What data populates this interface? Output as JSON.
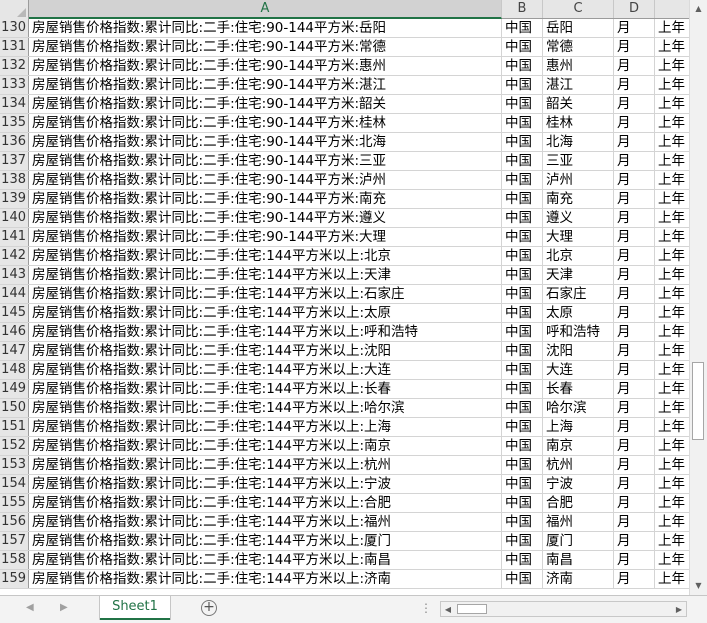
{
  "columns": [
    "A",
    "B",
    "C",
    "D",
    ""
  ],
  "selected_column": "A",
  "rows": [
    {
      "n": "130",
      "a": "房屋销售价格指数:累计同比:二手:住宅:90-144平方米:岳阳",
      "b": "中国",
      "c": "岳阳",
      "d": "月",
      "e": "上年"
    },
    {
      "n": "131",
      "a": "房屋销售价格指数:累计同比:二手:住宅:90-144平方米:常德",
      "b": "中国",
      "c": "常德",
      "d": "月",
      "e": "上年"
    },
    {
      "n": "132",
      "a": "房屋销售价格指数:累计同比:二手:住宅:90-144平方米:惠州",
      "b": "中国",
      "c": "惠州",
      "d": "月",
      "e": "上年"
    },
    {
      "n": "133",
      "a": "房屋销售价格指数:累计同比:二手:住宅:90-144平方米:湛江",
      "b": "中国",
      "c": "湛江",
      "d": "月",
      "e": "上年"
    },
    {
      "n": "134",
      "a": "房屋销售价格指数:累计同比:二手:住宅:90-144平方米:韶关",
      "b": "中国",
      "c": "韶关",
      "d": "月",
      "e": "上年"
    },
    {
      "n": "135",
      "a": "房屋销售价格指数:累计同比:二手:住宅:90-144平方米:桂林",
      "b": "中国",
      "c": "桂林",
      "d": "月",
      "e": "上年"
    },
    {
      "n": "136",
      "a": "房屋销售价格指数:累计同比:二手:住宅:90-144平方米:北海",
      "b": "中国",
      "c": "北海",
      "d": "月",
      "e": "上年"
    },
    {
      "n": "137",
      "a": "房屋销售价格指数:累计同比:二手:住宅:90-144平方米:三亚",
      "b": "中国",
      "c": "三亚",
      "d": "月",
      "e": "上年"
    },
    {
      "n": "138",
      "a": "房屋销售价格指数:累计同比:二手:住宅:90-144平方米:泸州",
      "b": "中国",
      "c": "泸州",
      "d": "月",
      "e": "上年"
    },
    {
      "n": "139",
      "a": "房屋销售价格指数:累计同比:二手:住宅:90-144平方米:南充",
      "b": "中国",
      "c": "南充",
      "d": "月",
      "e": "上年"
    },
    {
      "n": "140",
      "a": "房屋销售价格指数:累计同比:二手:住宅:90-144平方米:遵义",
      "b": "中国",
      "c": "遵义",
      "d": "月",
      "e": "上年"
    },
    {
      "n": "141",
      "a": "房屋销售价格指数:累计同比:二手:住宅:90-144平方米:大理",
      "b": "中国",
      "c": "大理",
      "d": "月",
      "e": "上年"
    },
    {
      "n": "142",
      "a": "房屋销售价格指数:累计同比:二手:住宅:144平方米以上:北京",
      "b": "中国",
      "c": "北京",
      "d": "月",
      "e": "上年"
    },
    {
      "n": "143",
      "a": "房屋销售价格指数:累计同比:二手:住宅:144平方米以上:天津",
      "b": "中国",
      "c": "天津",
      "d": "月",
      "e": "上年"
    },
    {
      "n": "144",
      "a": "房屋销售价格指数:累计同比:二手:住宅:144平方米以上:石家庄",
      "b": "中国",
      "c": "石家庄",
      "d": "月",
      "e": "上年"
    },
    {
      "n": "145",
      "a": "房屋销售价格指数:累计同比:二手:住宅:144平方米以上:太原",
      "b": "中国",
      "c": "太原",
      "d": "月",
      "e": "上年"
    },
    {
      "n": "146",
      "a": "房屋销售价格指数:累计同比:二手:住宅:144平方米以上:呼和浩特",
      "b": "中国",
      "c": "呼和浩特",
      "d": "月",
      "e": "上年"
    },
    {
      "n": "147",
      "a": "房屋销售价格指数:累计同比:二手:住宅:144平方米以上:沈阳",
      "b": "中国",
      "c": "沈阳",
      "d": "月",
      "e": "上年"
    },
    {
      "n": "148",
      "a": "房屋销售价格指数:累计同比:二手:住宅:144平方米以上:大连",
      "b": "中国",
      "c": "大连",
      "d": "月",
      "e": "上年"
    },
    {
      "n": "149",
      "a": "房屋销售价格指数:累计同比:二手:住宅:144平方米以上:长春",
      "b": "中国",
      "c": "长春",
      "d": "月",
      "e": "上年"
    },
    {
      "n": "150",
      "a": "房屋销售价格指数:累计同比:二手:住宅:144平方米以上:哈尔滨",
      "b": "中国",
      "c": "哈尔滨",
      "d": "月",
      "e": "上年"
    },
    {
      "n": "151",
      "a": "房屋销售价格指数:累计同比:二手:住宅:144平方米以上:上海",
      "b": "中国",
      "c": "上海",
      "d": "月",
      "e": "上年"
    },
    {
      "n": "152",
      "a": "房屋销售价格指数:累计同比:二手:住宅:144平方米以上:南京",
      "b": "中国",
      "c": "南京",
      "d": "月",
      "e": "上年"
    },
    {
      "n": "153",
      "a": "房屋销售价格指数:累计同比:二手:住宅:144平方米以上:杭州",
      "b": "中国",
      "c": "杭州",
      "d": "月",
      "e": "上年"
    },
    {
      "n": "154",
      "a": "房屋销售价格指数:累计同比:二手:住宅:144平方米以上:宁波",
      "b": "中国",
      "c": "宁波",
      "d": "月",
      "e": "上年"
    },
    {
      "n": "155",
      "a": "房屋销售价格指数:累计同比:二手:住宅:144平方米以上:合肥",
      "b": "中国",
      "c": "合肥",
      "d": "月",
      "e": "上年"
    },
    {
      "n": "156",
      "a": "房屋销售价格指数:累计同比:二手:住宅:144平方米以上:福州",
      "b": "中国",
      "c": "福州",
      "d": "月",
      "e": "上年"
    },
    {
      "n": "157",
      "a": "房屋销售价格指数:累计同比:二手:住宅:144平方米以上:厦门",
      "b": "中国",
      "c": "厦门",
      "d": "月",
      "e": "上年"
    },
    {
      "n": "158",
      "a": "房屋销售价格指数:累计同比:二手:住宅:144平方米以上:南昌",
      "b": "中国",
      "c": "南昌",
      "d": "月",
      "e": "上年"
    },
    {
      "n": "159",
      "a": "房屋销售价格指数:累计同比:二手:住宅:144平方米以上:济南",
      "b": "中国",
      "c": "济南",
      "d": "月",
      "e": "上年"
    }
  ],
  "sheet_tab": "Sheet1",
  "add_sheet_symbol": "+",
  "accent_color": "#217346",
  "icons": {
    "scroll_up": "triangle-up-icon",
    "scroll_down": "triangle-down-icon",
    "scroll_left": "triangle-left-icon",
    "scroll_right": "triangle-right-icon",
    "add_sheet": "plus-circle-icon"
  }
}
